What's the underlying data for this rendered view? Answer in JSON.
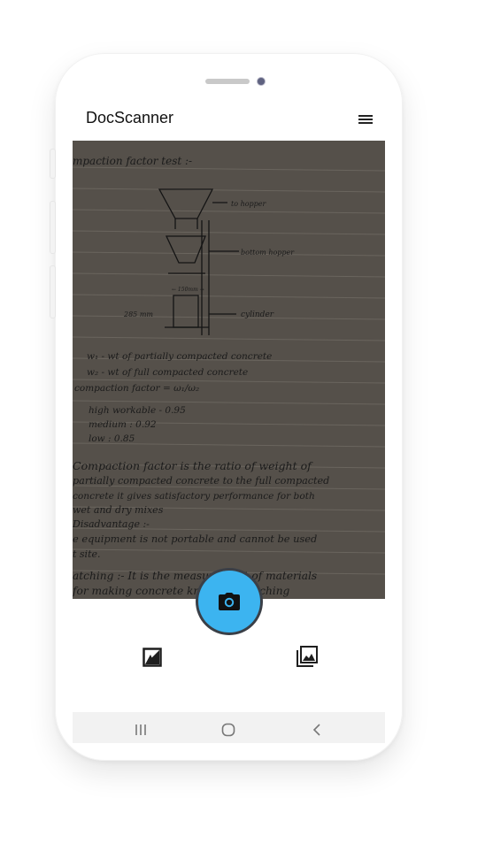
{
  "app": {
    "title": "DocScanner"
  },
  "header": {
    "menu_icon": "menu-icon"
  },
  "document": {
    "lines": [
      "mpaction factor test :-",
      "to hopper",
      "bottom hopper",
      "← 150mm →",
      "285 mm",
      "cylinder",
      "w₁ - wt of partially compacted concrete",
      "w₂ - wt of full compacted concrete",
      "compaction factor = ω₁/ω₂",
      "high workable - 0.95",
      "medium  :  0.92",
      "low  :  0.85",
      "Compaction factor is the ratio of weight of",
      "partially compacted concrete to the full compacted",
      "concrete it gives satisfactory performance for both",
      "wet and dry mixes",
      "Disadvantage :-",
      "e equipment is not portable and cannot be used",
      "t site.",
      "atching :- It is the measurement of materials",
      "for making concrete known as batching"
    ]
  },
  "toolbar": {
    "capture_icon": "camera-icon",
    "left_icon": "filter-mode-icon",
    "right_icon": "gallery-icon"
  },
  "system_nav": {
    "recents_icon": "recents-icon",
    "home_icon": "home-icon",
    "back_icon": "back-icon"
  },
  "colors": {
    "accent": "#3cb4f0",
    "document_bg": "#55504a",
    "navbar_bg": "#f2f2f2"
  }
}
